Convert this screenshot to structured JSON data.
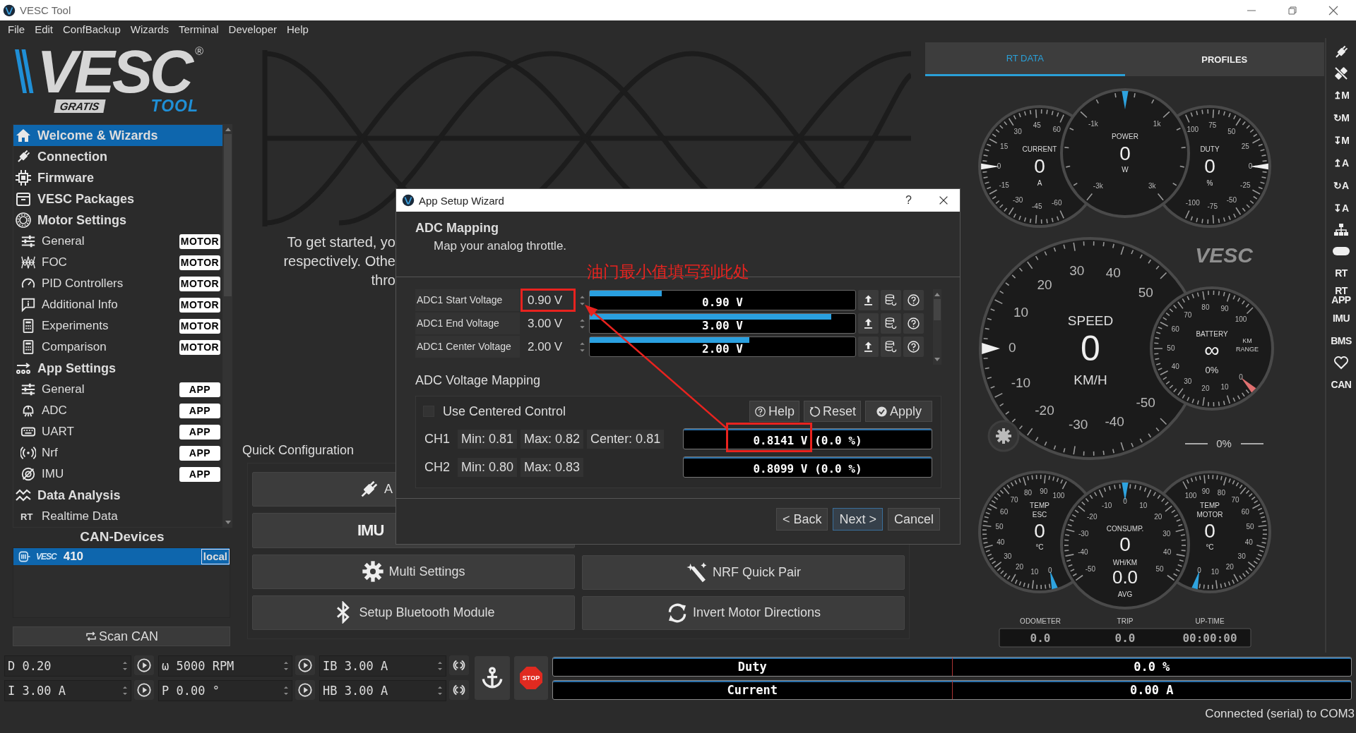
{
  "window": {
    "title": "VESC Tool"
  },
  "menu": [
    "File",
    "Edit",
    "ConfBackup",
    "Wizards",
    "Terminal",
    "Developer",
    "Help"
  ],
  "logo": {
    "wordmark": "VESC",
    "registered": "®",
    "edition": "GRATIS",
    "product": "TOOL"
  },
  "sidebar": {
    "items": [
      {
        "label": "Welcome & Wizards",
        "kind": "header",
        "selected": true
      },
      {
        "label": "Connection",
        "kind": "header",
        "selected": false
      },
      {
        "label": "Firmware",
        "kind": "header",
        "selected": false
      },
      {
        "label": "VESC Packages",
        "kind": "header",
        "selected": false
      },
      {
        "label": "Motor Settings",
        "kind": "header",
        "selected": false
      },
      {
        "label": "General",
        "kind": "sub",
        "tag": "MOTOR",
        "selected": false
      },
      {
        "label": "FOC",
        "kind": "sub",
        "tag": "MOTOR",
        "selected": false
      },
      {
        "label": "PID Controllers",
        "kind": "sub",
        "tag": "MOTOR",
        "selected": false
      },
      {
        "label": "Additional Info",
        "kind": "sub",
        "tag": "MOTOR",
        "selected": false
      },
      {
        "label": "Experiments",
        "kind": "sub",
        "tag": "MOTOR",
        "selected": false
      },
      {
        "label": "Comparison",
        "kind": "sub",
        "tag": "MOTOR",
        "selected": false
      },
      {
        "label": "App Settings",
        "kind": "header",
        "selected": false
      },
      {
        "label": "General",
        "kind": "sub",
        "tag": "APP",
        "selected": false
      },
      {
        "label": "ADC",
        "kind": "sub",
        "tag": "APP",
        "selected": false
      },
      {
        "label": "UART",
        "kind": "sub",
        "tag": "APP",
        "selected": false
      },
      {
        "label": "Nrf",
        "kind": "sub",
        "tag": "APP",
        "selected": false
      },
      {
        "label": "IMU",
        "kind": "sub",
        "tag": "APP",
        "selected": false
      },
      {
        "label": "Data Analysis",
        "kind": "header",
        "selected": false
      },
      {
        "label": "Realtime Data",
        "kind": "sub",
        "icon_text": "RT",
        "selected": false
      }
    ]
  },
  "can_devices": {
    "title": "CAN-Devices",
    "devices": [
      {
        "brand": "VESC",
        "id": "410",
        "tag": "local",
        "selected": true
      }
    ],
    "scan_button": "Scan CAN"
  },
  "welcome": {
    "lines": [
      "To get started, yo",
      "respectively. Othe",
      "thro"
    ]
  },
  "quick_config": {
    "title": "Quick Configuration",
    "left_column": [
      {
        "label": "A"
      },
      {
        "icon_text": "IMU"
      },
      {
        "label": "Multi Settings"
      },
      {
        "label": "Setup Bluetooth Module"
      }
    ],
    "right_column": [
      {
        "label": "NRF Quick Pair"
      },
      {
        "label": "Invert Motor Directions"
      }
    ]
  },
  "wizard": {
    "title": "App Setup Wizard",
    "help": "?",
    "page_title": "ADC Mapping",
    "page_subtitle": "Map your analog throttle.",
    "annotation": "油门最小值填写到此处",
    "params": [
      {
        "name": "ADC1 Start Voltage",
        "value": "0.90 V",
        "level": 0.27,
        "reading": "0.90 V",
        "highlighted": true
      },
      {
        "name": "ADC1 End Voltage",
        "value": "3.00 V",
        "level": 0.91,
        "reading": "3.00 V",
        "highlighted": false
      },
      {
        "name": "ADC1 Center Voltage",
        "value": "2.00 V",
        "level": 0.6,
        "reading": "2.00 V",
        "highlighted": false
      }
    ],
    "mapping": {
      "title": "ADC Voltage Mapping",
      "centered_control": {
        "label": "Use Centered Control",
        "checked": false
      },
      "buttons": [
        "Help",
        "Reset",
        "Apply"
      ],
      "channels": [
        {
          "name": "CH1",
          "min": "Min: 0.81",
          "max": "Max: 0.82",
          "center": "Center: 0.81",
          "reading": "0.8141 V (0.0 %)",
          "highlighted": true
        },
        {
          "name": "CH2",
          "min": "Min: 0.80",
          "max": "Max: 0.83",
          "reading": "0.8099 V (0.0 %)",
          "highlighted": false
        }
      ]
    },
    "buttons": [
      {
        "label": "< Back",
        "default": false
      },
      {
        "label": "Next >",
        "default": true
      },
      {
        "label": "Cancel",
        "default": false
      }
    ]
  },
  "rt_tabs": [
    {
      "label": "RT DATA",
      "selected": true
    },
    {
      "label": "PROFILES",
      "selected": false
    }
  ],
  "gauges": [
    {
      "kind": "current",
      "title": "CURRENT",
      "value": "0",
      "unit": "A",
      "labels": [
        "-60",
        "-45",
        "-30",
        "-15",
        "0",
        "15",
        "30",
        "45",
        "60"
      ]
    },
    {
      "kind": "power",
      "title": "POWER",
      "value": "0",
      "unit": "W",
      "labels": [
        "-1k",
        "1k",
        "-3k",
        "3k"
      ]
    },
    {
      "kind": "duty",
      "title": "DUTY",
      "value": "0",
      "unit": "%",
      "labels": [
        "100",
        "75",
        "50",
        "25",
        "0",
        "-25",
        "-50",
        "-75",
        "-100"
      ]
    },
    {
      "kind": "speed",
      "title": "SPEED",
      "value": "0",
      "unit": "KM/H",
      "labels": [
        "30",
        "40",
        "20",
        "50",
        "10",
        "0",
        "-10",
        "-50",
        "-20",
        "-40",
        "-30"
      ]
    },
    {
      "kind": "battery",
      "title": "BATTERY",
      "value": "∞",
      "unit": "0%",
      "range_label": [
        "KM",
        "RANGE"
      ],
      "labels": [
        "0",
        "10",
        "20",
        "30",
        "40",
        "50",
        "60",
        "70",
        "80",
        "90",
        "100"
      ]
    },
    {
      "kind": "temp_esc",
      "title": "TEMP",
      "subtitle": "ESC",
      "value": "0",
      "unit": "°C",
      "labels": [
        "0",
        "10",
        "20",
        "30",
        "40",
        "50",
        "60",
        "70",
        "80",
        "90",
        "100"
      ]
    },
    {
      "kind": "consumption",
      "title": "CONSUMP.",
      "value": "0",
      "unit": "WH/KM",
      "avg_value": "0.0",
      "avg_label": "AVG",
      "labels": [
        "-50",
        "-40",
        "-30",
        "-20",
        "-10",
        "0",
        "10",
        "20",
        "30",
        "40",
        "50"
      ]
    },
    {
      "kind": "temp_motor",
      "title": "TEMP",
      "subtitle": "MOTOR",
      "value": "0",
      "unit": "°C",
      "labels": [
        "100",
        "90",
        "80",
        "70",
        "60",
        "50",
        "40",
        "30",
        "20",
        "10",
        "0"
      ]
    }
  ],
  "dash_logo": "VESC",
  "throttle_readout": "0%",
  "trip_stats": [
    {
      "label": "ODOMETER",
      "value": "0.0"
    },
    {
      "label": "TRIP",
      "value": "0.0"
    },
    {
      "label": "UP-TIME",
      "value": "00:00:00"
    }
  ],
  "toolbar": [
    {
      "kind": "glyph"
    },
    {
      "kind": "glyph"
    },
    {
      "kind": "text",
      "label": "↥M"
    },
    {
      "kind": "text",
      "label": "↻M"
    },
    {
      "kind": "text",
      "label": "↧M"
    },
    {
      "kind": "text",
      "label": "↥A"
    },
    {
      "kind": "text",
      "label": "↻A"
    },
    {
      "kind": "text",
      "label": "↧A"
    },
    {
      "kind": "glyph"
    },
    {
      "kind": "glyph"
    },
    {
      "kind": "text",
      "label": "RT"
    },
    {
      "kind": "text",
      "label": "RT APP"
    },
    {
      "kind": "text",
      "label": "IMU"
    },
    {
      "kind": "text",
      "label": "BMS"
    },
    {
      "kind": "glyph"
    },
    {
      "kind": "text",
      "label": "CAN"
    }
  ],
  "controls": [
    "D 0.20",
    "ω 5000 RPM",
    "IB 3.00 A",
    "I 3.00 A",
    "P 0.00 °",
    "HB 3.00 A"
  ],
  "stop_label": "STOP",
  "readouts": [
    {
      "label": "Duty",
      "value": "0.0 %"
    },
    {
      "label": "Current",
      "value": "0.00 A"
    }
  ],
  "status_bar": "Connected (serial) to COM3"
}
